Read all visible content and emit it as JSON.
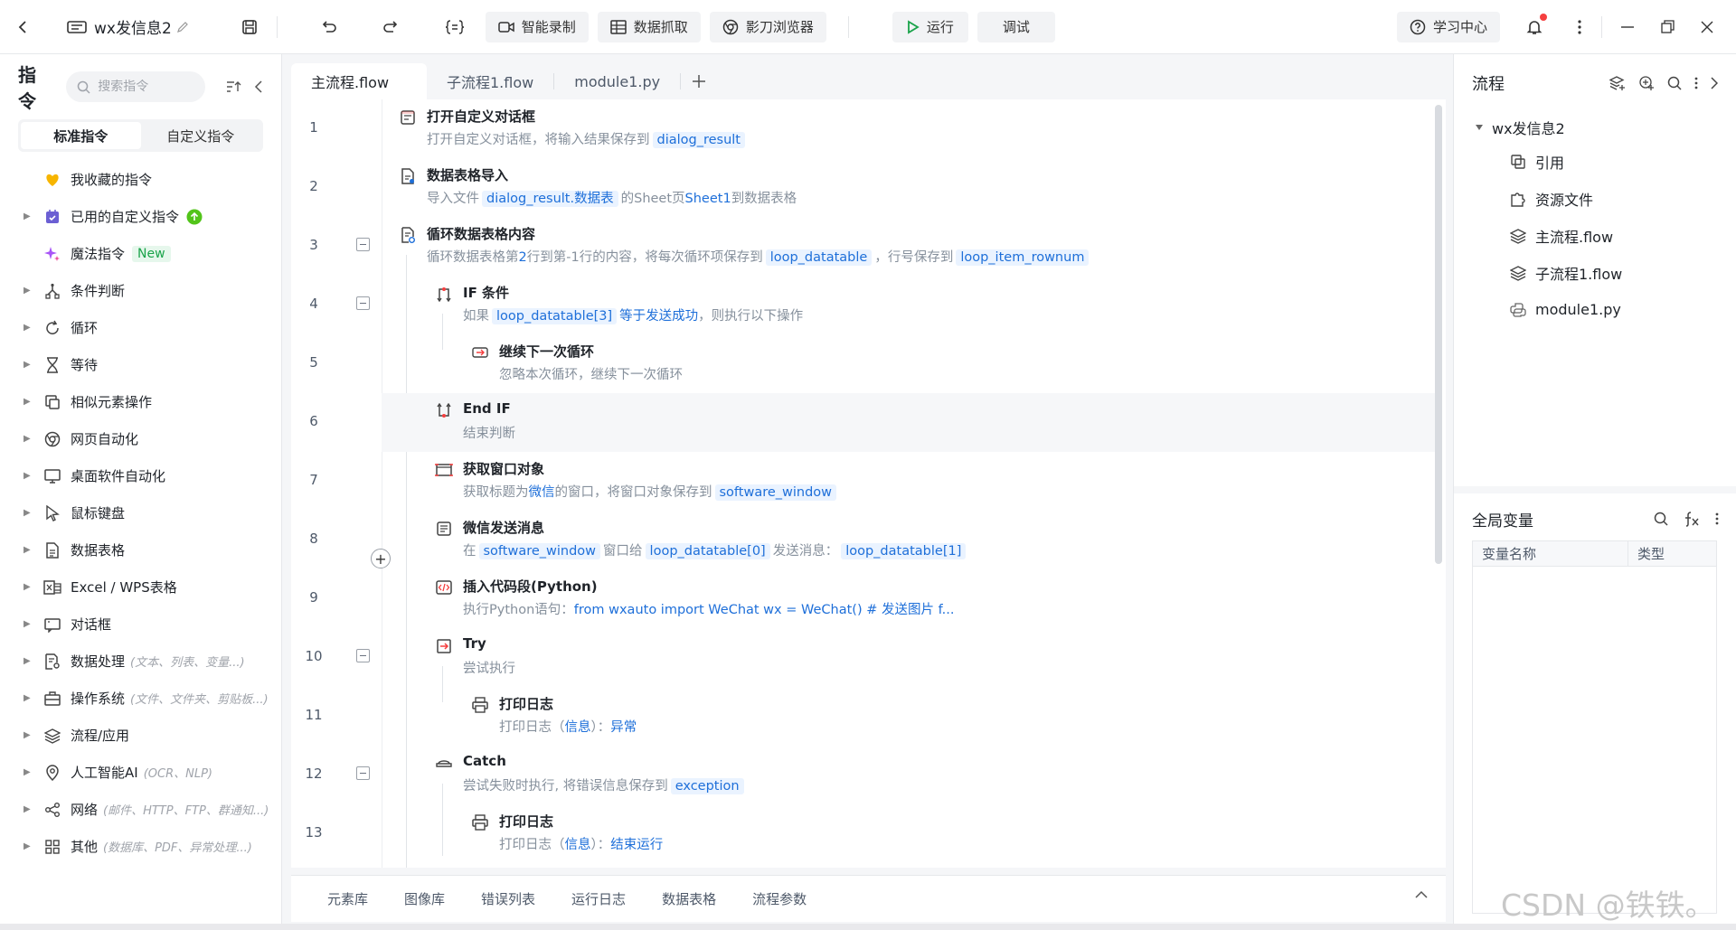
{
  "toolbar": {
    "title": "wx发信息2",
    "smart_record": "智能录制",
    "data_capture": "数据抓取",
    "browser": "影刀浏览器",
    "run": "运行",
    "debug": "调试",
    "learning": "学习中心"
  },
  "left": {
    "title": "指令",
    "search_placeholder": "搜索指令",
    "tab_standard": "标准指令",
    "tab_custom": "自定义指令",
    "items": [
      {
        "label": "我收藏的指令",
        "icon": "heart-icon",
        "hint": "",
        "caret": false
      },
      {
        "label": "已用的自定义指令",
        "icon": "calendar-check-icon",
        "hint": "",
        "caret": true
      },
      {
        "label": "魔法指令",
        "icon": "sparkle-icon",
        "hint": "",
        "caret": false,
        "badge": "New"
      },
      {
        "label": "条件判断",
        "icon": "branch-icon",
        "hint": "",
        "caret": true
      },
      {
        "label": "循环",
        "icon": "loop-icon",
        "hint": "",
        "caret": true
      },
      {
        "label": "等待",
        "icon": "hourglass-icon",
        "hint": "",
        "caret": true
      },
      {
        "label": "相似元素操作",
        "icon": "copy-icon",
        "hint": "",
        "caret": true
      },
      {
        "label": "网页自动化",
        "icon": "browser-icon",
        "hint": "",
        "caret": true
      },
      {
        "label": "桌面软件自动化",
        "icon": "monitor-icon",
        "hint": "",
        "caret": true
      },
      {
        "label": "鼠标键盘",
        "icon": "cursor-icon",
        "hint": "",
        "caret": true
      },
      {
        "label": "数据表格",
        "icon": "sheet-icon",
        "hint": "",
        "caret": true
      },
      {
        "label": "Excel / WPS表格",
        "icon": "excel-icon",
        "hint": "",
        "caret": true
      },
      {
        "label": "对话框",
        "icon": "dialog-icon",
        "hint": "",
        "caret": true
      },
      {
        "label": "数据处理",
        "icon": "data-process-icon",
        "hint": "(文本、列表、变量...)",
        "caret": true
      },
      {
        "label": "操作系统",
        "icon": "toolbox-icon",
        "hint": "(文件、文件夹、剪贴板...)",
        "caret": true
      },
      {
        "label": "流程/应用",
        "icon": "layers-icon",
        "hint": "",
        "caret": true
      },
      {
        "label": "人工智能AI",
        "icon": "location-icon",
        "hint": "(OCR、NLP)",
        "caret": true
      },
      {
        "label": "网络",
        "icon": "share-icon",
        "hint": "(邮件、HTTP、FTP、群通知...)",
        "caret": true
      },
      {
        "label": "其他",
        "icon": "grid-icon",
        "hint": "(数据库、PDF、异常处理...)",
        "caret": true
      }
    ]
  },
  "tabs": [
    "主流程.flow",
    "子流程1.flow",
    "module1.py"
  ],
  "steps": {
    "s1": {
      "num": "1",
      "title": "打开自定义对话框",
      "d1": "打开自定义对话框，将输入结果保存到",
      "v1": "dialog_result"
    },
    "s2": {
      "num": "2",
      "title": "数据表格导入",
      "d1": "导入文件",
      "v1": "dialog_result.数据表",
      "d2": "的Sheet页",
      "k1": "Sheet1",
      "d3": "到数据表格"
    },
    "s3": {
      "num": "3",
      "title": "循环数据表格内容",
      "d1": "循环数据表格第",
      "k1": "2",
      "d2": "行到第-1行的内容，将每次循环项保存到",
      "v1": "loop_datatable",
      "d3": "，行号保存到",
      "v2": "loop_item_rownum"
    },
    "s4": {
      "num": "4",
      "title": "IF 条件",
      "d1": "如果",
      "v1": "loop_datatable[3]",
      "k1": "等于",
      "v2": "发送成功",
      "d2": "，则执行以下操作"
    },
    "s5": {
      "num": "5",
      "title": "继续下一次循环",
      "d1": "忽略本次循环，继续下一次循环"
    },
    "s6": {
      "num": "6",
      "title": "End IF",
      "d1": "结束判断"
    },
    "s7": {
      "num": "7",
      "title": "获取窗口对象",
      "d1": "获取标题为",
      "k1": "微信",
      "d2": "的窗口，将窗口对象保存到",
      "v1": "software_window"
    },
    "s8": {
      "num": "8",
      "title": "微信发送消息",
      "d1": "在",
      "v1": "software_window",
      "d2": "窗口给",
      "v2": "loop_datatable[0]",
      "d3": "发送消息：",
      "v3": "loop_datatable[1]"
    },
    "s9": {
      "num": "9",
      "title": "插入代码段(Python)",
      "d1": "执行Python语句：",
      "k1": "from wxauto import WeChat  wx = WeChat()  # 发送图片 f..."
    },
    "s10": {
      "num": "10",
      "title": "Try",
      "d1": "尝试执行"
    },
    "s11": {
      "num": "11",
      "title": "打印日志",
      "d1": "打印日志（",
      "k1": "信息",
      "d2": "）：",
      "k2": "异常"
    },
    "s12": {
      "num": "12",
      "title": "Catch",
      "d1": "尝试失败时执行, 将错误信息保存到",
      "v1": "exception"
    },
    "s13": {
      "num": "13",
      "title": "打印日志",
      "d1": "打印日志（",
      "k1": "信息",
      "d2": "）：",
      "k2": "结束运行"
    }
  },
  "bottom_tabs": [
    "元素库",
    "图像库",
    "错误列表",
    "运行日志",
    "数据表格",
    "流程参数"
  ],
  "right": {
    "flow_title": "流程",
    "root": "wx发信息2",
    "items": [
      {
        "label": "引用",
        "icon": "reference-icon"
      },
      {
        "label": "资源文件",
        "icon": "puzzle-icon"
      },
      {
        "label": "主流程.flow",
        "icon": "layers-icon"
      },
      {
        "label": "子流程1.flow",
        "icon": "layers-icon"
      },
      {
        "label": "module1.py",
        "icon": "python-icon"
      }
    ],
    "globals_title": "全局变量",
    "col_name": "变量名称",
    "col_type": "类型"
  },
  "watermark": "CSDN @铁铁。",
  "colors": {
    "accent": "#1e6fd9",
    "run_green": "#1aa34a",
    "notify_red": "#f53f3f"
  }
}
